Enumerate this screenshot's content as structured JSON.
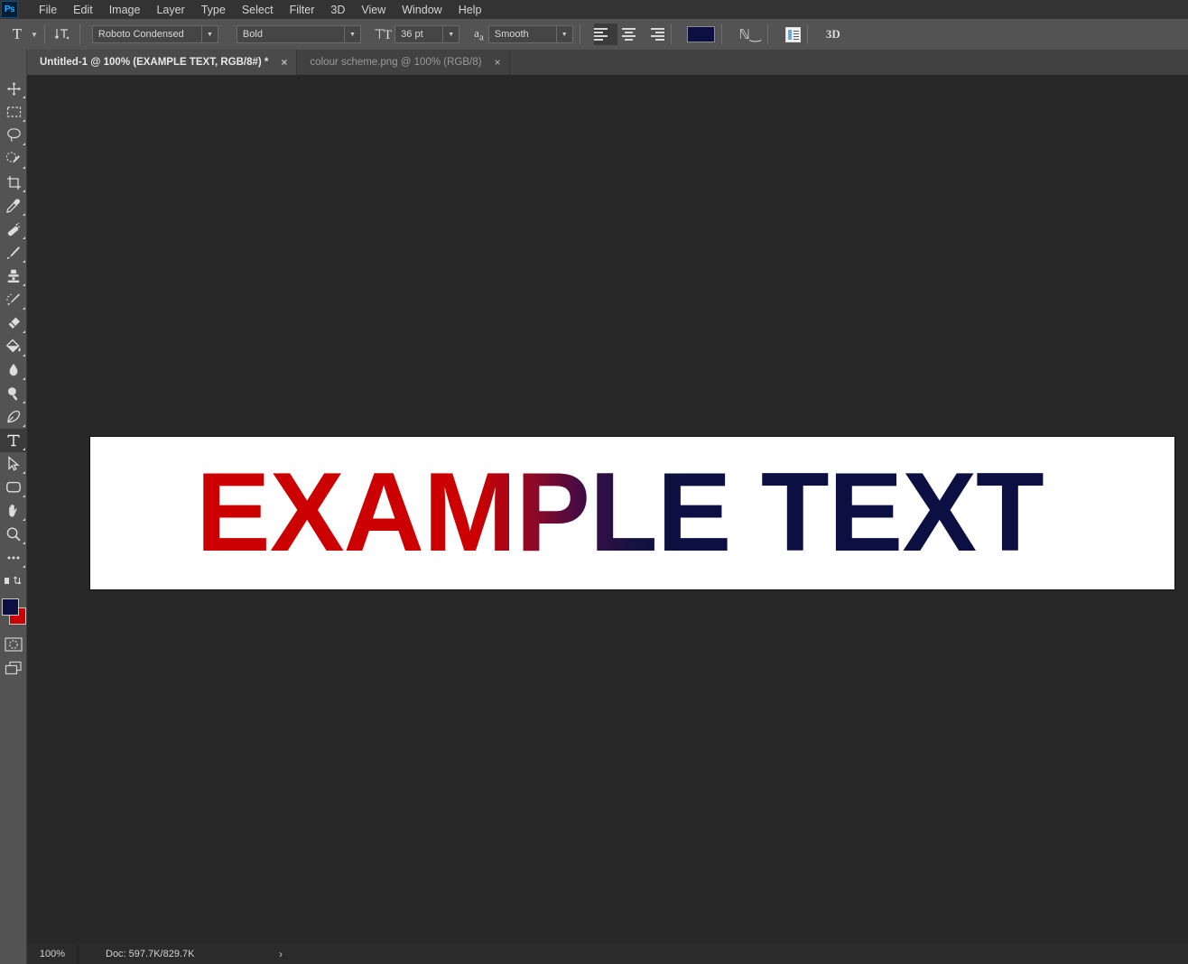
{
  "app": {
    "name": "Adobe Photoshop",
    "logo_text": "Ps"
  },
  "menubar": {
    "items": [
      {
        "label": "File"
      },
      {
        "label": "Edit"
      },
      {
        "label": "Image"
      },
      {
        "label": "Layer"
      },
      {
        "label": "Type"
      },
      {
        "label": "Select"
      },
      {
        "label": "Filter"
      },
      {
        "label": "3D"
      },
      {
        "label": "View"
      },
      {
        "label": "Window"
      },
      {
        "label": "Help"
      }
    ]
  },
  "options_bar": {
    "tool_preset_glyph": "T",
    "orientation_icon": "text-orientation-icon",
    "font_family": "Roboto Condensed",
    "font_style": "Bold",
    "font_size": "36 pt",
    "anti_aliasing": "Smooth",
    "alignment": {
      "left": "align-left",
      "center": "align-center",
      "right": "align-right",
      "active": "left"
    },
    "text_color": "#0b0f42",
    "warp_icon": "warp-text-icon",
    "panel_icon": "character-paragraph-panels-icon",
    "threed_label": "3D"
  },
  "toolbar": {
    "tools": [
      {
        "name": "move-tool",
        "label": "Move Tool",
        "active": false
      },
      {
        "name": "rectangular-marquee-tool",
        "label": "Rectangular Marquee Tool",
        "active": false
      },
      {
        "name": "lasso-tool",
        "label": "Lasso Tool",
        "active": false
      },
      {
        "name": "quick-selection-tool",
        "label": "Quick Selection Tool",
        "active": false
      },
      {
        "name": "crop-tool",
        "label": "Crop Tool",
        "active": false
      },
      {
        "name": "eyedropper-tool",
        "label": "Eyedropper Tool",
        "active": false
      },
      {
        "name": "spot-healing-brush-tool",
        "label": "Spot Healing Brush Tool",
        "active": false
      },
      {
        "name": "brush-tool",
        "label": "Brush Tool",
        "active": false
      },
      {
        "name": "clone-stamp-tool",
        "label": "Clone Stamp Tool",
        "active": false
      },
      {
        "name": "history-brush-tool",
        "label": "History Brush Tool",
        "active": false
      },
      {
        "name": "eraser-tool",
        "label": "Eraser Tool",
        "active": false
      },
      {
        "name": "gradient-tool",
        "label": "Gradient Tool",
        "active": false
      },
      {
        "name": "blur-tool",
        "label": "Blur Tool",
        "active": false
      },
      {
        "name": "dodge-tool",
        "label": "Dodge Tool",
        "active": false
      },
      {
        "name": "pen-tool",
        "label": "Pen Tool",
        "active": false
      },
      {
        "name": "horizontal-type-tool",
        "label": "Horizontal Type Tool",
        "active": true
      },
      {
        "name": "path-selection-tool",
        "label": "Path Selection Tool",
        "active": false
      },
      {
        "name": "rectangle-tool",
        "label": "Rectangle Tool",
        "active": false
      },
      {
        "name": "hand-tool",
        "label": "Hand Tool",
        "active": false
      },
      {
        "name": "zoom-tool",
        "label": "Zoom Tool",
        "active": false
      },
      {
        "name": "edit-toolbar-tool",
        "label": "Edit Toolbar",
        "active": false
      }
    ],
    "foreground_color": "#0b0f42",
    "background_color": "#cc0000",
    "quick_mask_label": "Edit in Quick Mask Mode",
    "screen_mode_label": "Change Screen Mode"
  },
  "tabs": [
    {
      "title": "Untitled-1 @ 100% (EXAMPLE TEXT, RGB/8#) *",
      "close": "×",
      "active": true
    },
    {
      "title": "colour scheme.png @ 100% (RGB/8)",
      "close": "×",
      "active": false
    }
  ],
  "canvas": {
    "artwork_text": "EXAMPLE TEXT",
    "background": "#ffffff",
    "gradient_start": "#cc0000",
    "gradient_end": "#0b0f42"
  },
  "statusbar": {
    "zoom": "100%",
    "doc_info": "Doc: 597.7K/829.7K",
    "expand_arrow": "›"
  }
}
